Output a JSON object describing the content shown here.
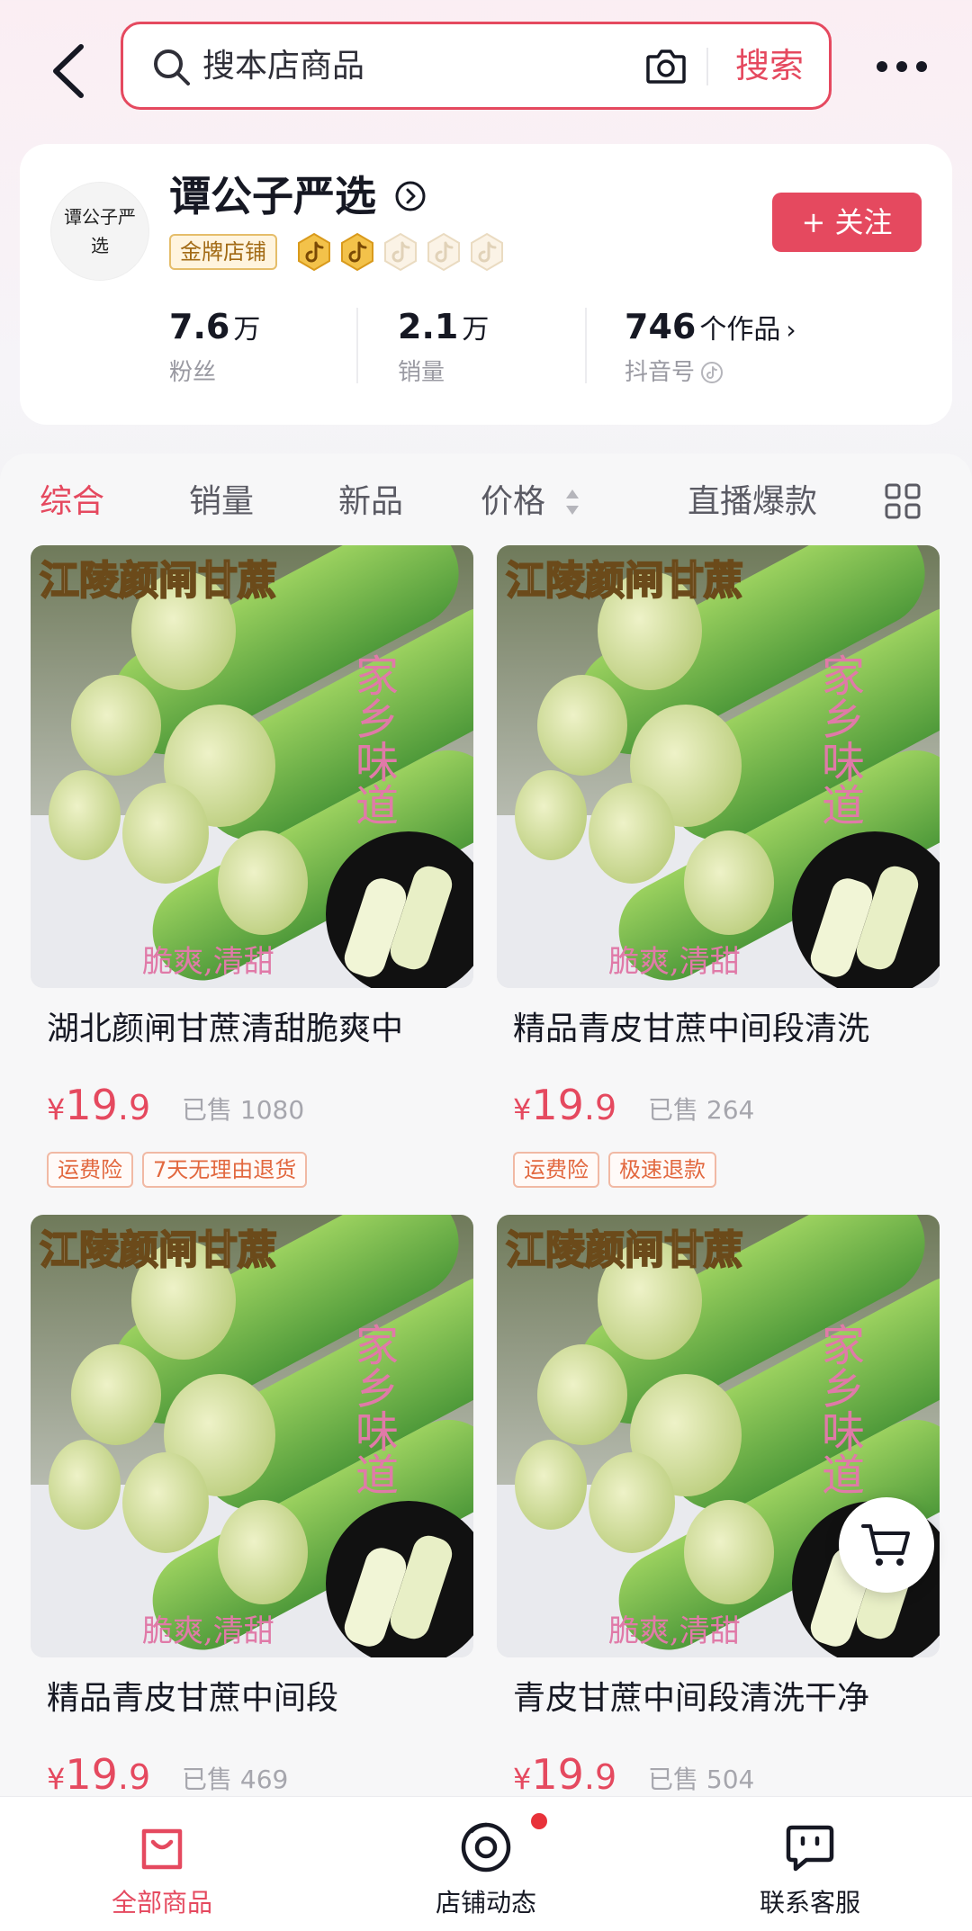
{
  "header": {
    "search_placeholder": "搜本店商品",
    "search_button": "搜索"
  },
  "shop": {
    "avatar_text": "谭公子严选",
    "name": "谭公子严选",
    "badge": "金牌店铺",
    "level_icons": [
      "douyin-gold-icon",
      "douyin-gold-icon",
      "douyin-gray-icon",
      "douyin-gray-icon",
      "douyin-gray-icon"
    ],
    "follow_label": "+ 关注",
    "stats": [
      {
        "value": "7.6",
        "unit": "万",
        "label": "粉丝"
      },
      {
        "value": "2.1",
        "unit": "万",
        "label": "销量"
      },
      {
        "value": "746",
        "unit": "个作品",
        "label": "抖音号"
      }
    ]
  },
  "tabs": {
    "all": "综合",
    "sales": "销量",
    "new": "新品",
    "price": "价格",
    "live": "直播爆款"
  },
  "product_image": {
    "banner": "江陵颜闸甘蔗",
    "side_text": "家乡味道",
    "bottom_text": "脆爽,清甜"
  },
  "products": [
    {
      "title": "湖北颜闸甘蔗清甜脆爽中",
      "currency": "¥",
      "price_int": "19",
      "price_dec": ".9",
      "sold": "已售 1080",
      "tags": [
        "运费险",
        "7天无理由退货"
      ]
    },
    {
      "title": "精品青皮甘蔗中间段清洗",
      "currency": "¥",
      "price_int": "19",
      "price_dec": ".9",
      "sold": "已售 264",
      "tags": [
        "运费险",
        "极速退款"
      ]
    },
    {
      "title": "精品青皮甘蔗中间段",
      "currency": "¥",
      "price_int": "19",
      "price_dec": ".9",
      "sold": "已售 469",
      "tags": []
    },
    {
      "title": "青皮甘蔗中间段清洗干净",
      "currency": "¥",
      "price_int": "19",
      "price_dec": ".9",
      "sold": "已售 504",
      "tags": []
    }
  ],
  "bottom_nav": {
    "all_products": "全部商品",
    "shop_feed": "店铺动态",
    "customer_service": "联系客服"
  },
  "colors": {
    "accent": "#e5495f",
    "tag_text": "#e2683f",
    "gold": "#e5bd6a"
  }
}
